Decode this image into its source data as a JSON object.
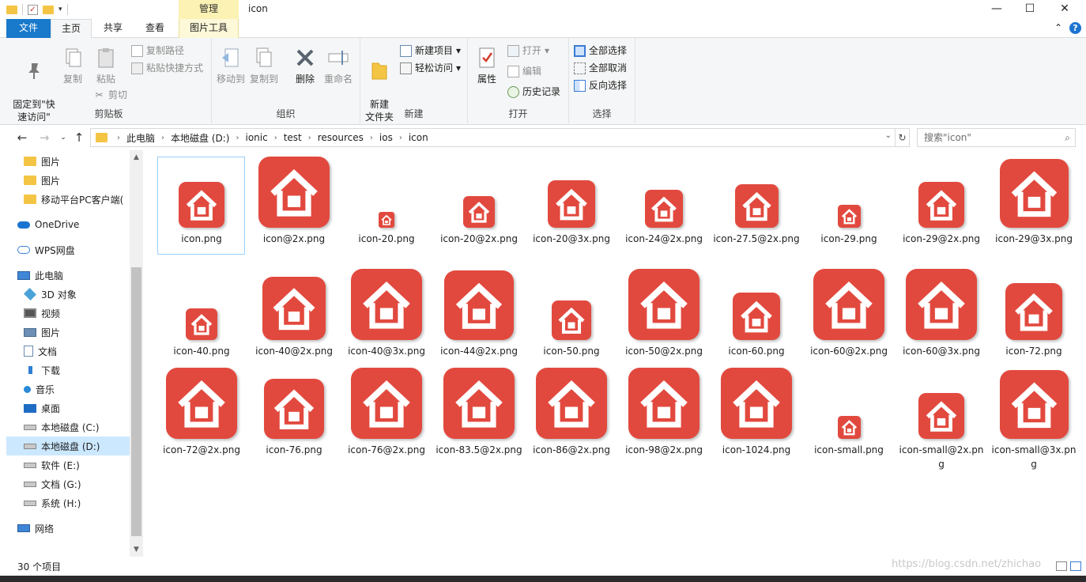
{
  "window": {
    "title": "icon",
    "context_tab": "管理",
    "controls": {
      "minimize": "—",
      "maximize": "☐",
      "close": "✕"
    }
  },
  "ribbon_tabs": {
    "file": "文件",
    "home": "主页",
    "share": "共享",
    "view": "查看",
    "picture_tools": "图片工具",
    "collapse": "⌃",
    "help": "?"
  },
  "ribbon": {
    "clipboard": {
      "label": "剪贴板",
      "pin": "固定到\"快\n速访问\"",
      "copy": "复制",
      "paste": "粘贴",
      "copy_path": "复制路径",
      "paste_shortcut": "粘贴快捷方式",
      "cut": "剪切"
    },
    "organize": {
      "label": "组织",
      "move_to": "移动到",
      "copy_to": "复制到",
      "delete": "删除",
      "rename": "重命名"
    },
    "new": {
      "label": "新建",
      "new_folder": "新建\n文件夹",
      "new_item": "新建项目",
      "easy_access": "轻松访问"
    },
    "open": {
      "label": "打开",
      "properties": "属性",
      "open": "打开",
      "edit": "编辑",
      "history": "历史记录"
    },
    "select": {
      "label": "选择",
      "select_all": "全部选择",
      "select_none": "全部取消",
      "invert": "反向选择"
    }
  },
  "address": {
    "crumbs": [
      "此电脑",
      "本地磁盘 (D:)",
      "ionic",
      "test",
      "resources",
      "ios",
      "icon"
    ],
    "search_placeholder": "搜索\"icon\""
  },
  "sidebar": {
    "items": [
      {
        "label": "图片",
        "icon": "folder-icon"
      },
      {
        "label": "图片",
        "icon": "folder-icon"
      },
      {
        "label": "移动平台PC客户端(",
        "icon": "folder-icon"
      },
      {
        "label": "OneDrive",
        "icon": "cloud-icon"
      },
      {
        "label": "WPS网盘",
        "icon": "cloud-outline-icon"
      },
      {
        "label": "此电脑",
        "icon": "computer-icon"
      },
      {
        "label": "3D 对象",
        "icon": "cube-icon"
      },
      {
        "label": "视频",
        "icon": "video-icon"
      },
      {
        "label": "图片",
        "icon": "pictures-icon"
      },
      {
        "label": "文档",
        "icon": "document-icon"
      },
      {
        "label": "下载",
        "icon": "download-icon"
      },
      {
        "label": "音乐",
        "icon": "music-icon"
      },
      {
        "label": "桌面",
        "icon": "desktop-icon"
      },
      {
        "label": "本地磁盘 (C:)",
        "icon": "drive-icon"
      },
      {
        "label": "本地磁盘 (D:)",
        "icon": "drive-icon"
      },
      {
        "label": "软件 (E:)",
        "icon": "drive-icon"
      },
      {
        "label": "文档 (G:)",
        "icon": "drive-icon"
      },
      {
        "label": "系统 (H:)",
        "icon": "drive-icon"
      },
      {
        "label": "网络",
        "icon": "network-icon"
      }
    ]
  },
  "files": [
    {
      "name": "icon.png",
      "size": 58
    },
    {
      "name": "icon@2x.png",
      "size": 90
    },
    {
      "name": "icon-20.png",
      "size": 20
    },
    {
      "name": "icon-20@2x.png",
      "size": 40
    },
    {
      "name": "icon-20@3x.png",
      "size": 60
    },
    {
      "name": "icon-24@2x.png",
      "size": 48
    },
    {
      "name": "icon-27.5@2x.png",
      "size": 55
    },
    {
      "name": "icon-29.png",
      "size": 29
    },
    {
      "name": "icon-29@2x.png",
      "size": 58
    },
    {
      "name": "icon-29@3x.png",
      "size": 87
    },
    {
      "name": "icon-40.png",
      "size": 40
    },
    {
      "name": "icon-40@2x.png",
      "size": 80
    },
    {
      "name": "icon-40@3x.png",
      "size": 90
    },
    {
      "name": "icon-44@2x.png",
      "size": 88
    },
    {
      "name": "icon-50.png",
      "size": 50
    },
    {
      "name": "icon-50@2x.png",
      "size": 90
    },
    {
      "name": "icon-60.png",
      "size": 60
    },
    {
      "name": "icon-60@2x.png",
      "size": 90
    },
    {
      "name": "icon-60@3x.png",
      "size": 90
    },
    {
      "name": "icon-72.png",
      "size": 72
    },
    {
      "name": "icon-72@2x.png",
      "size": 90
    },
    {
      "name": "icon-76.png",
      "size": 76
    },
    {
      "name": "icon-76@2x.png",
      "size": 90
    },
    {
      "name": "icon-83.5@2x.png",
      "size": 90
    },
    {
      "name": "icon-86@2x.png",
      "size": 90
    },
    {
      "name": "icon-98@2x.png",
      "size": 90
    },
    {
      "name": "icon-1024.png",
      "size": 90
    },
    {
      "name": "icon-small.png",
      "size": 29
    },
    {
      "name": "icon-small@2x.png",
      "size": 58
    },
    {
      "name": "icon-small@3x.png",
      "size": 87
    }
  ],
  "status": {
    "count": "30 个项目",
    "watermark": "https://blog.csdn.net/zhichao"
  },
  "colors": {
    "accent": "#1979ca",
    "icon_red": "#e2493e",
    "selection": "#cce8ff"
  }
}
